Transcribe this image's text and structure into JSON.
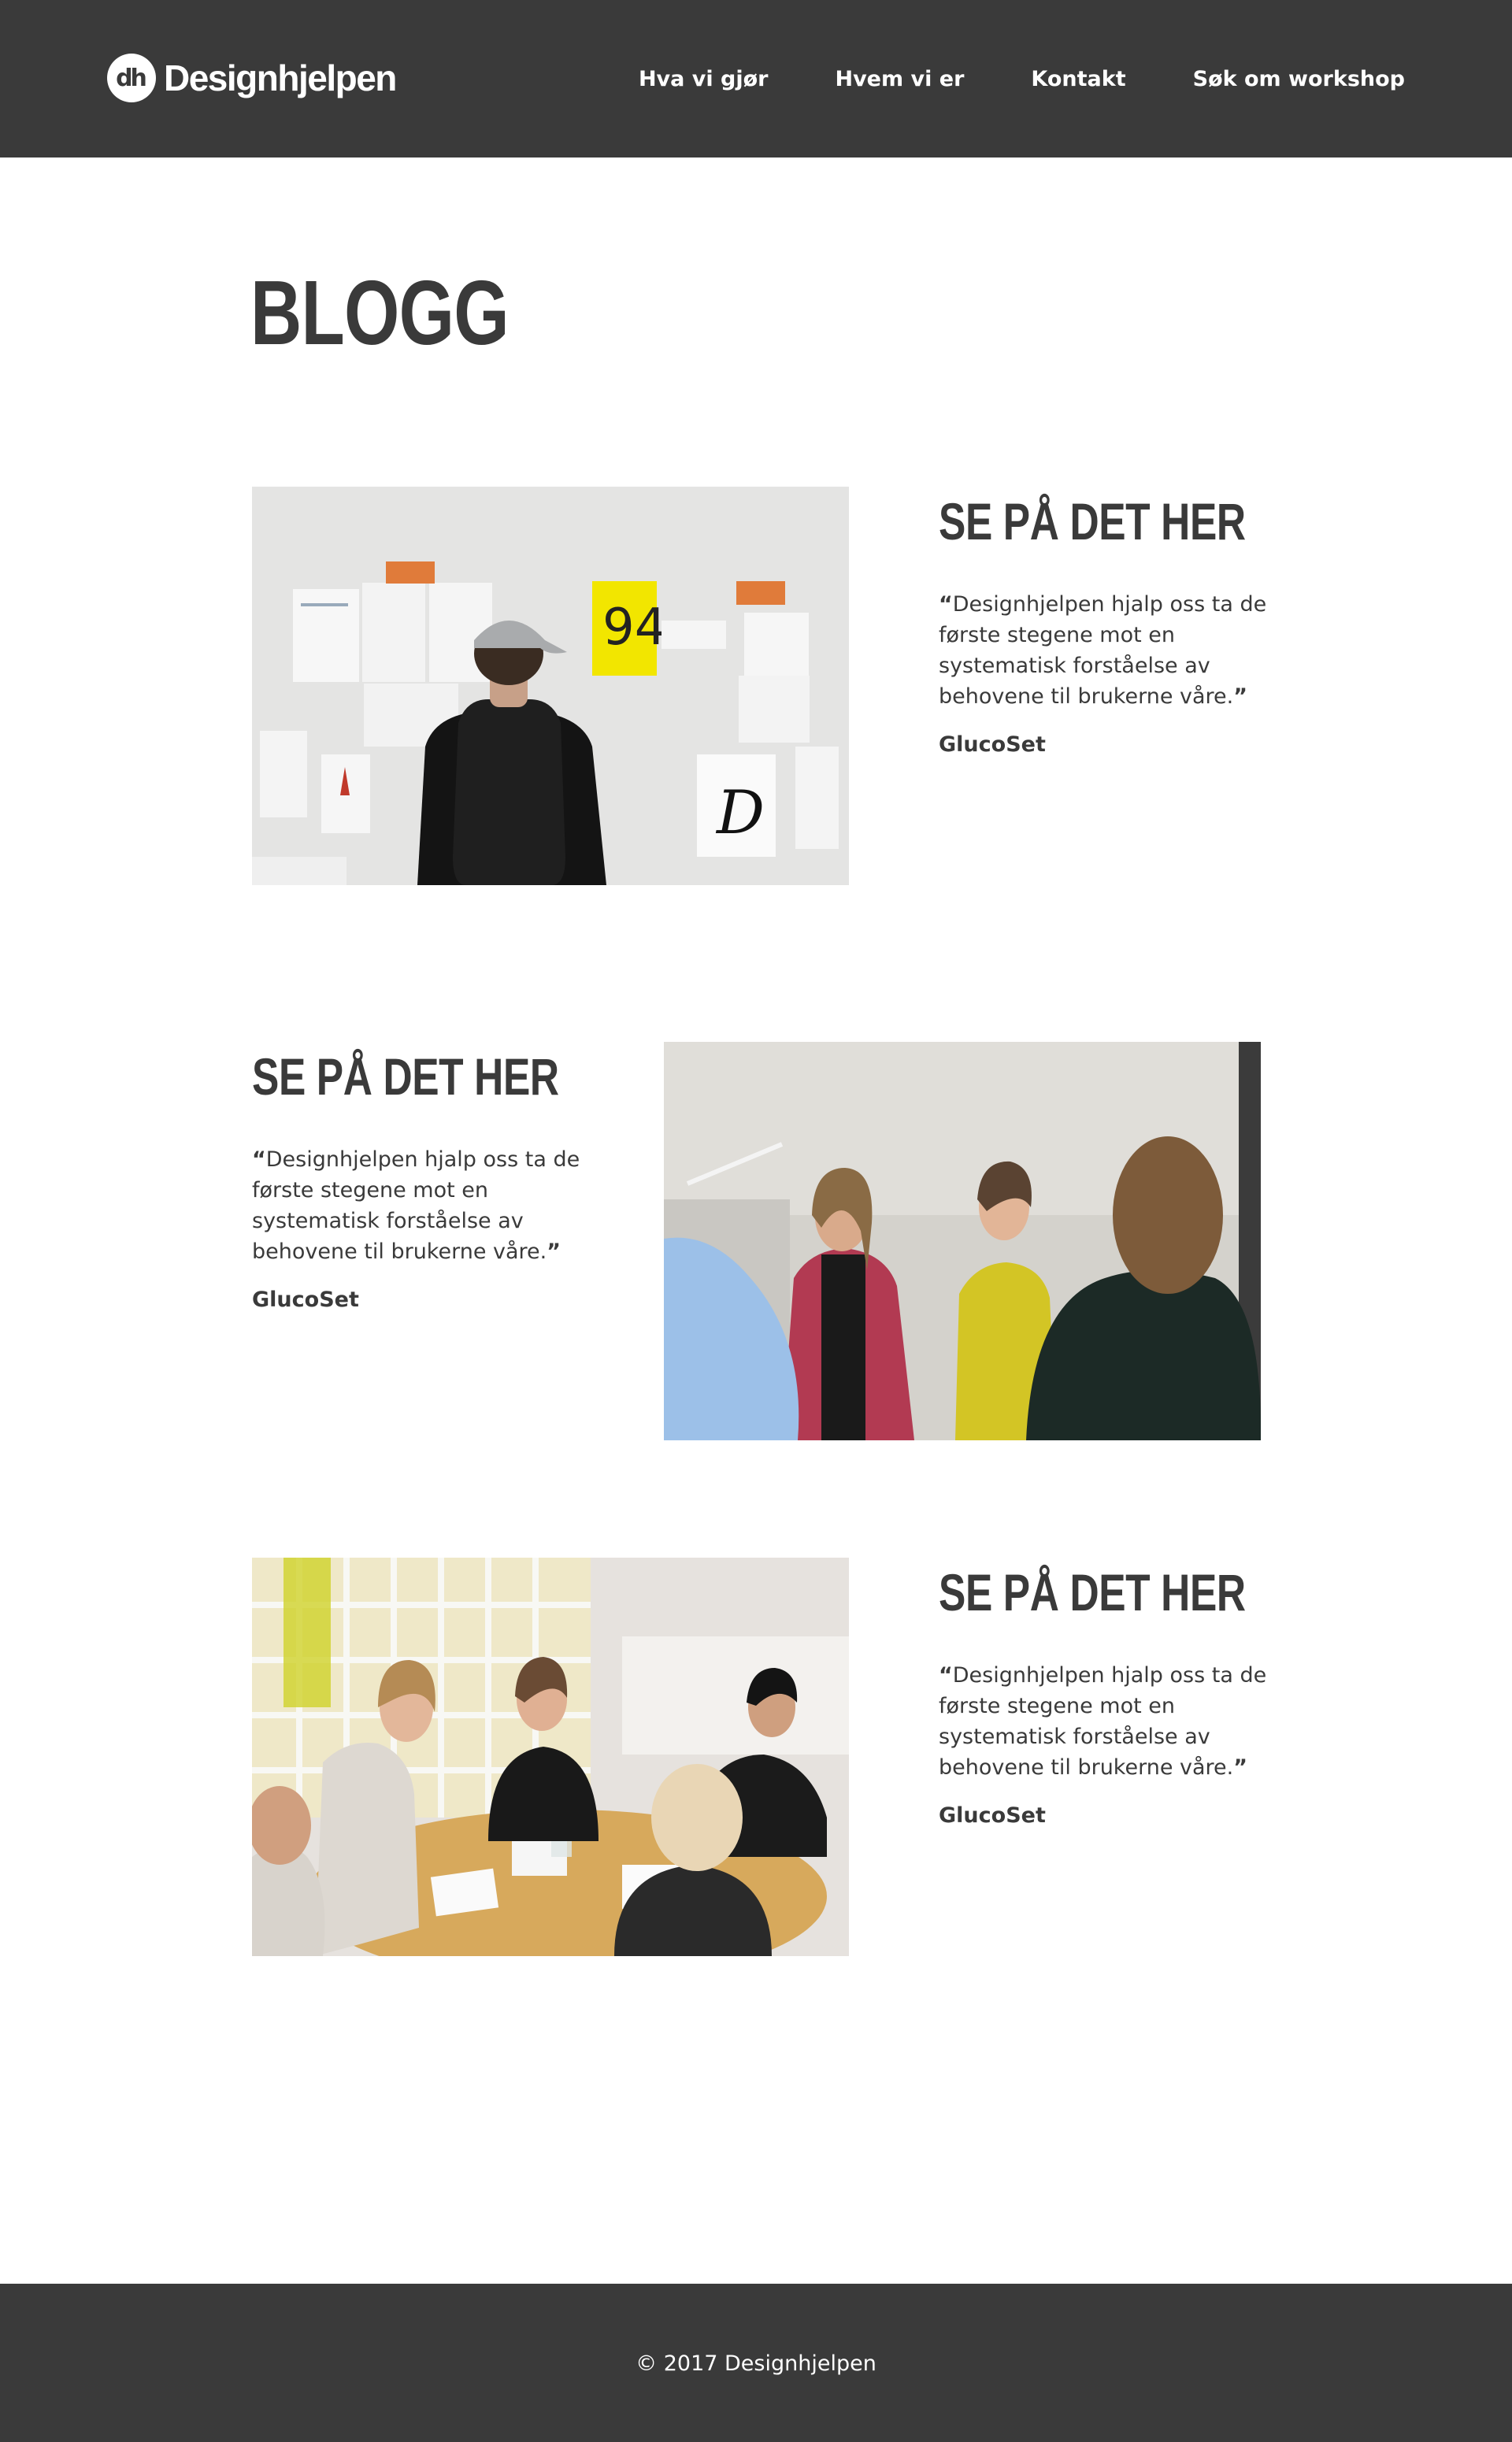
{
  "header": {
    "logo_mark": "dh",
    "logo_text": "Designhjelpen",
    "nav": [
      {
        "label": "Hva vi gjør"
      },
      {
        "label": "Hvem vi er"
      },
      {
        "label": "Kontakt"
      },
      {
        "label": "Søk om workshop"
      }
    ]
  },
  "page": {
    "title": "BLOGG"
  },
  "posts": [
    {
      "heading": "SE PÅ DET HER",
      "quote_open": "“",
      "quote": "Designhjelpen hjalp oss ta de første stegene mot en systematisk forståelse av behovene til brukerne våre.",
      "quote_close": "”",
      "author": "GlucoSet",
      "image_alt": "Man with cap viewing posters on a wall"
    },
    {
      "heading": "SE PÅ DET HER",
      "quote_open": "“",
      "quote": "Designhjelpen hjalp oss ta de første stegene mot en systematisk forståelse av behovene til brukerne våre.",
      "quote_close": "”",
      "author": "GlucoSet",
      "image_alt": "Group of young people talking"
    },
    {
      "heading": "SE PÅ DET HER",
      "quote_open": "“",
      "quote": "Designhjelpen hjalp oss ta de første stegene mot en systematisk forståelse av behovene til brukerne våre.",
      "quote_close": "”",
      "author": "GlucoSet",
      "image_alt": "Workshop around a table"
    }
  ],
  "footer": {
    "copyright": "© 2017 Designhjelpen"
  },
  "colors": {
    "dark": "#3a3a3a",
    "background": "#ffffff",
    "text_light": "#ffffff"
  }
}
